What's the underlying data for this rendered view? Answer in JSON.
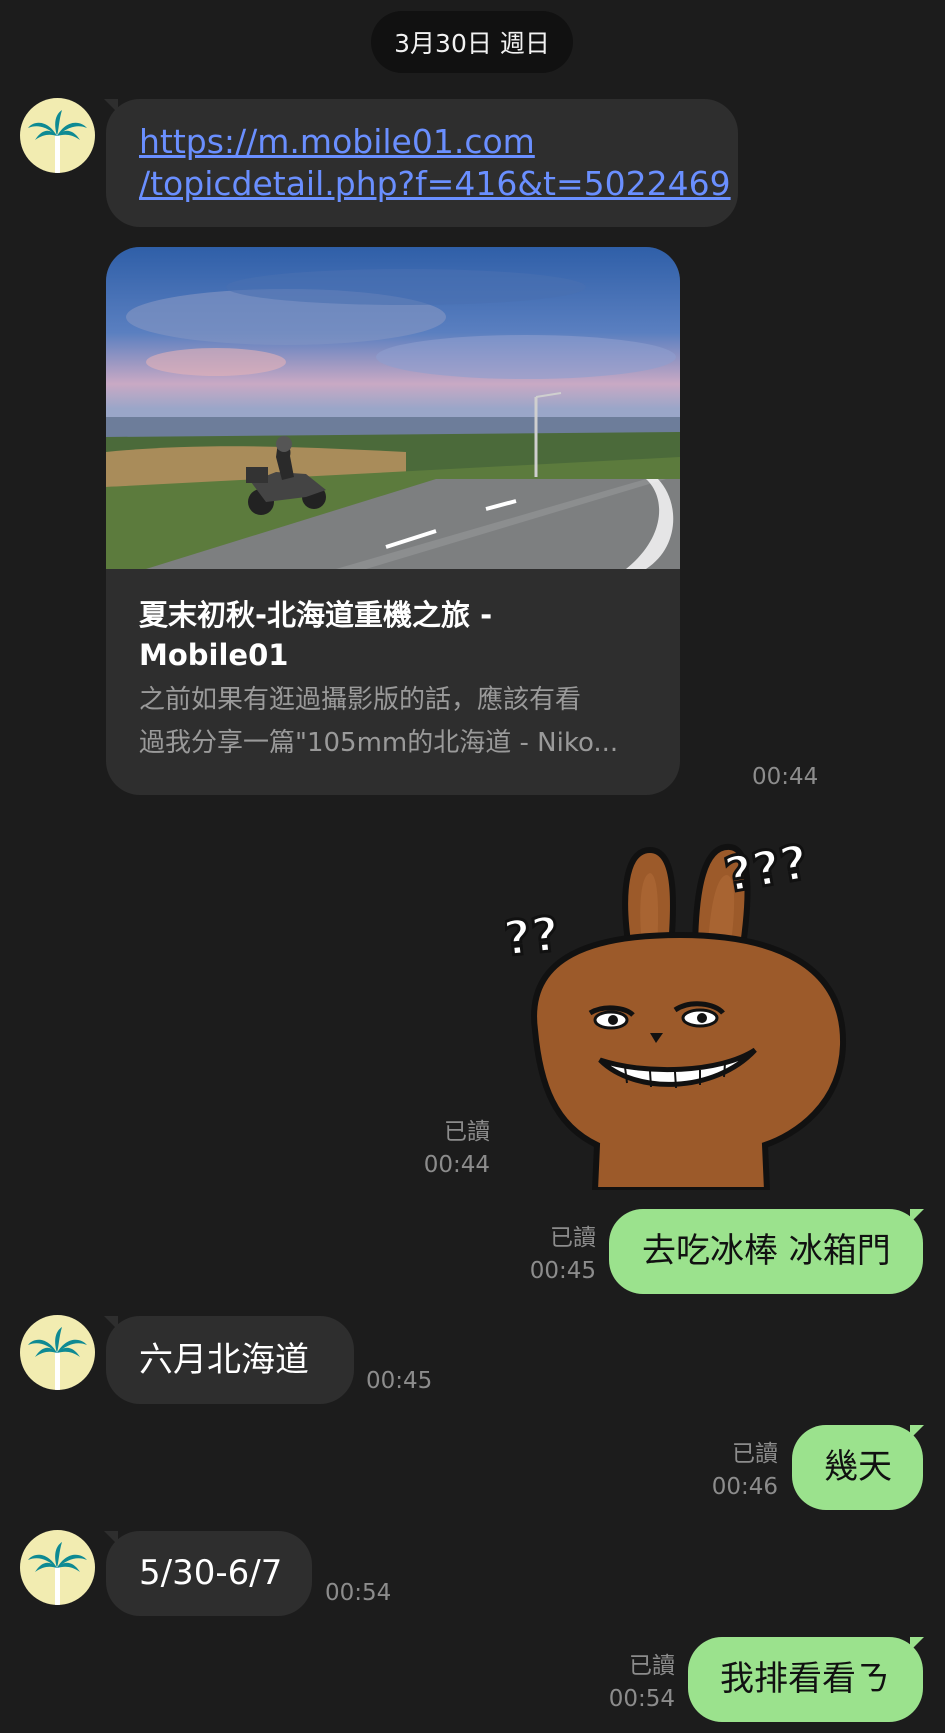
{
  "chat": {
    "date_label": "3月30日 週日",
    "link_message": {
      "line1": "https://m.mobile01.com",
      "line2": "/topicdetail.php?f=416&t=5022469"
    },
    "preview": {
      "title": "夏末初秋-北海道重機之旅 - Mobile01",
      "description_line1": "之前如果有逛過攝影版的話，應該有看",
      "description_line2": "過我分享一篇\"105mm的北海道 - Niko...",
      "time": "00:44"
    },
    "sticker": {
      "read_label": "已讀",
      "time": "00:44",
      "icon": "bunny-sticker",
      "text_left": "???",
      "text_right": "???"
    },
    "messages": [
      {
        "side": "out",
        "text": "去吃冰棒 冰箱門",
        "read_label": "已讀",
        "time": "00:45"
      },
      {
        "side": "in",
        "text": "六月北海道",
        "time": "00:45"
      },
      {
        "side": "out",
        "text": "幾天",
        "read_label": "已讀",
        "time": "00:46"
      },
      {
        "side": "in",
        "text": "5/30-6/7",
        "time": "00:54"
      },
      {
        "side": "out",
        "text": "我排看看ㄋ",
        "read_label": "已讀",
        "time": "00:54"
      }
    ]
  },
  "colors": {
    "background": "#1c1c1c",
    "incoming_bubble": "#2e2e2e",
    "outgoing_bubble": "#9be28d",
    "link": "#6a8fff",
    "timestamp": "#8c8c8c"
  }
}
